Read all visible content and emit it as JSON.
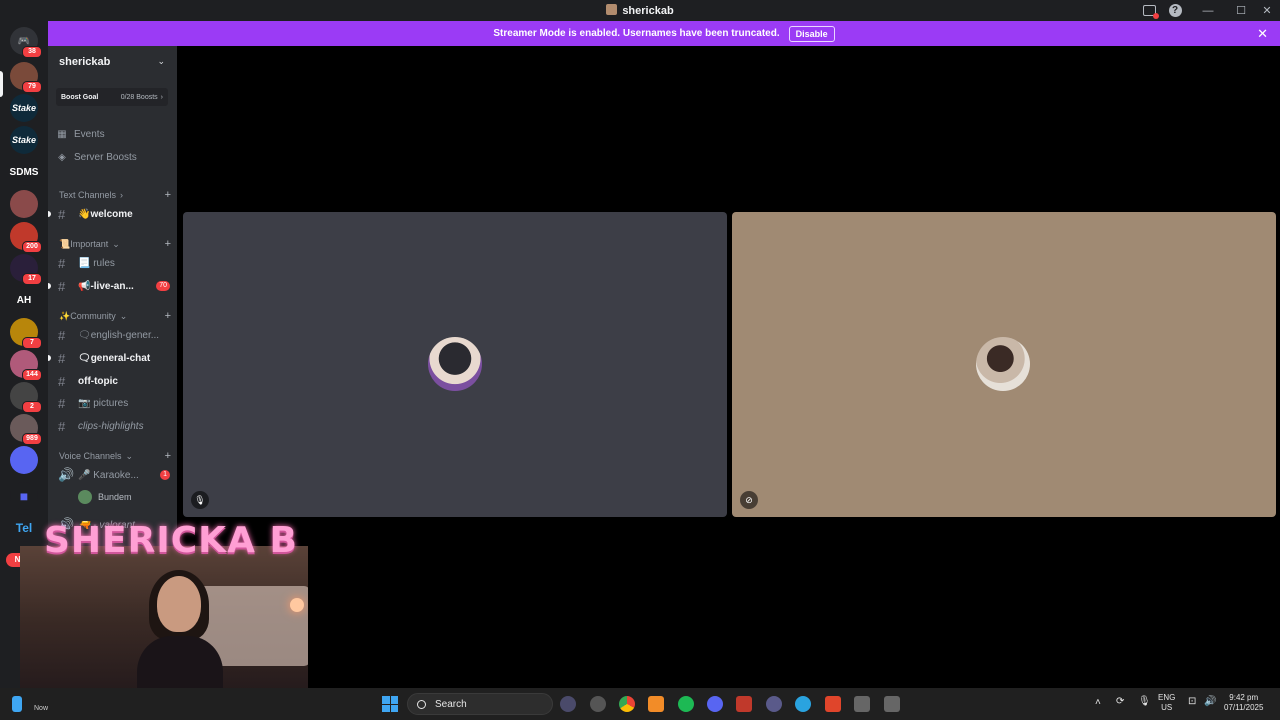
{
  "window": {
    "title": "sherickab"
  },
  "banner": {
    "message": "Streamer Mode is enabled. Usernames have been truncated.",
    "button": "Disable"
  },
  "server_rail": {
    "badges": [
      "38",
      "79",
      "200",
      "17",
      "7",
      "144",
      "2",
      "989"
    ],
    "text_servers": [
      "SDMS",
      "AH"
    ],
    "new_label": "NEW"
  },
  "sidebar": {
    "server_name": "sherickab",
    "boost_label": "Boost Goal",
    "boost_count": "0/28 Boosts",
    "events": "Events",
    "server_boosts": "Server Boosts",
    "cat_text": "Text Channels",
    "ch_welcome": "👋welcome",
    "cat_important": "📜Important",
    "ch_rules": "📃 rules",
    "ch_live": "📢-live-an...",
    "live_badge": "70",
    "cat_community": "✨Community",
    "ch_english": "🗨english-gener...",
    "ch_general": "🗨general-chat",
    "ch_offtopic": "off-topic",
    "ch_pictures": "📷 pictures",
    "ch_clips": "clips-highlights",
    "cat_voice": "Voice Channels",
    "vc_karaoke": "🎤 Karaoke...",
    "karaoke_badge": "1",
    "vc_user": "Bundem",
    "vc_valorant": "🔫 - valorant"
  },
  "overlay": {
    "name": "SHERICKA B"
  },
  "taskbar": {
    "search": "Search",
    "lang": "ENG",
    "region": "US",
    "time": "9:42 pm",
    "date": "07/11/2025",
    "now_label": "Now"
  },
  "colors": {
    "banner": "#9b3bf5",
    "tile_left": "#3d3e47",
    "tile_right": "#a08a73",
    "mention": "#f23f42"
  }
}
